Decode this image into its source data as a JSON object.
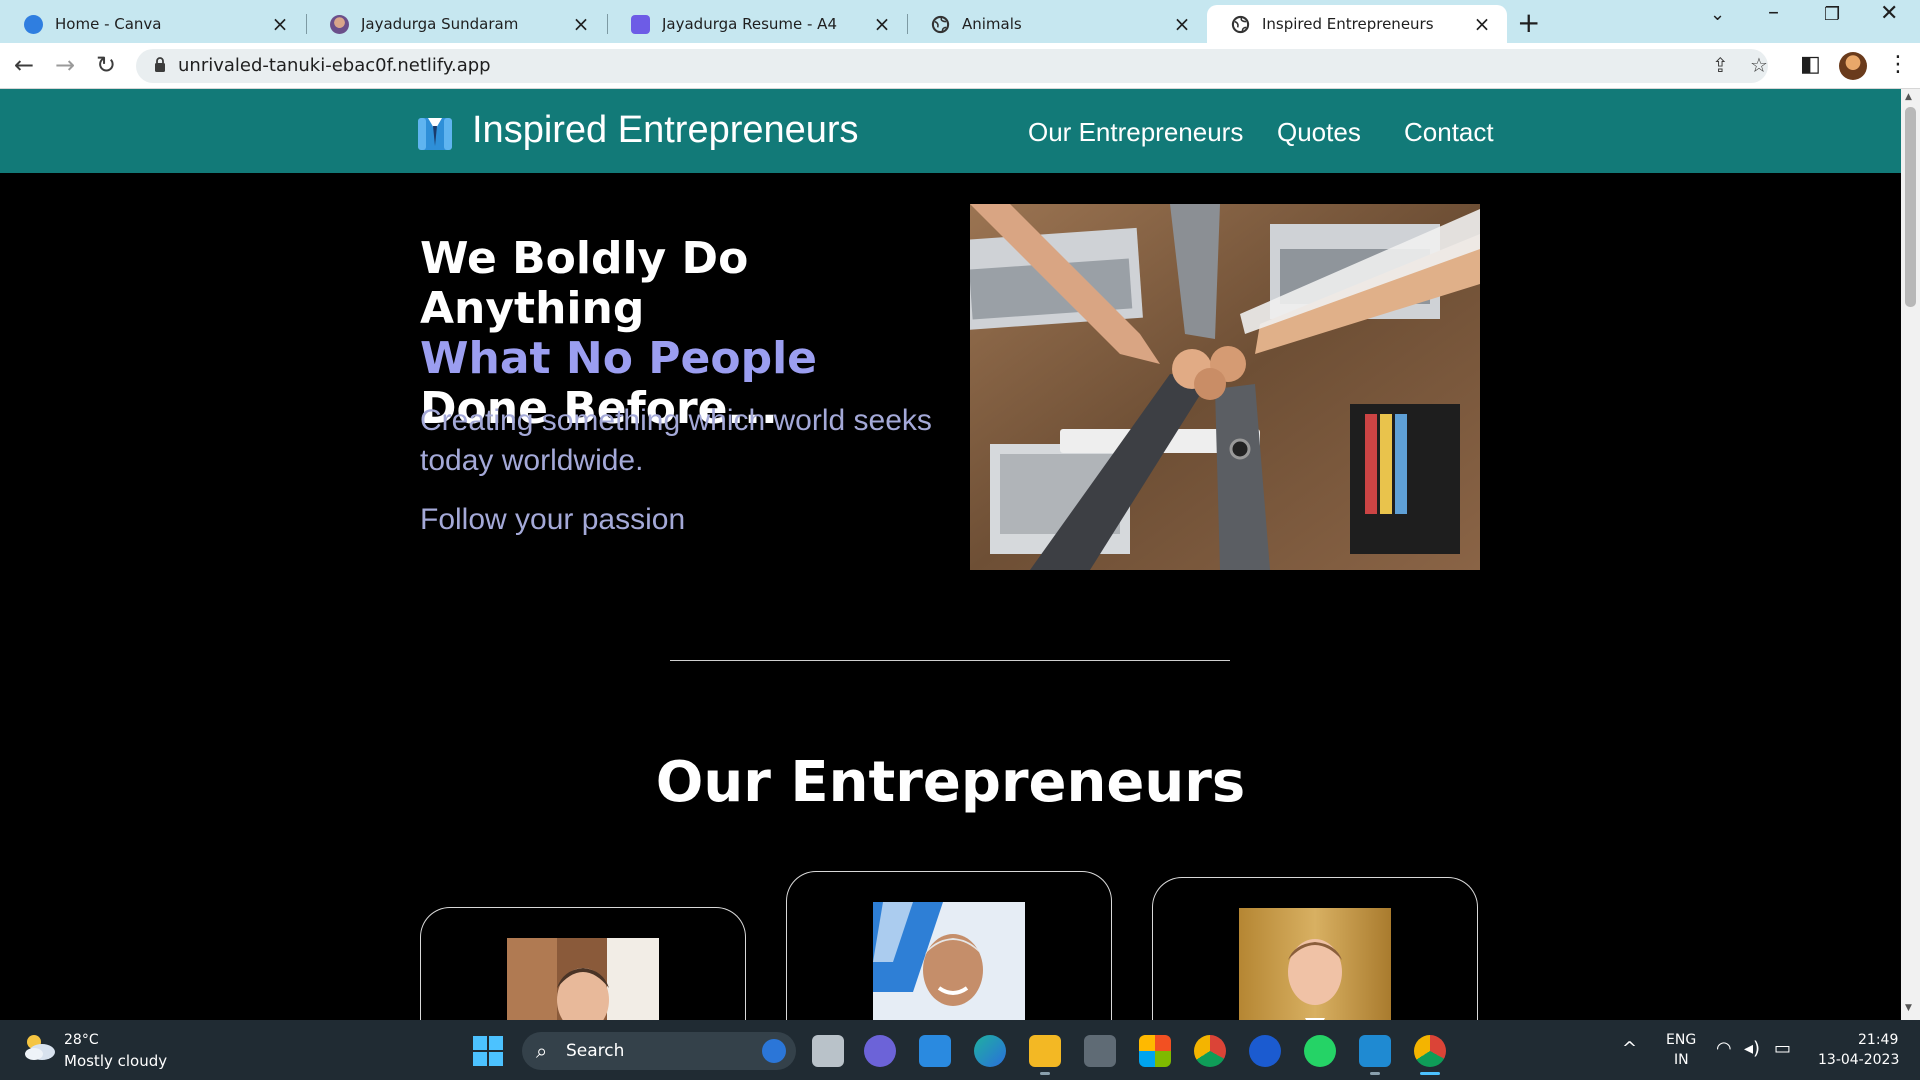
{
  "browser": {
    "tabs": [
      {
        "title": "Home - Canva",
        "icon": "canva-icon",
        "active": false
      },
      {
        "title": "Jayadurga Sundaram",
        "icon": "profile-photo-icon",
        "active": false
      },
      {
        "title": "Jayadurga Resume - A4",
        "icon": "printer-icon",
        "active": false
      },
      {
        "title": "Animals",
        "icon": "globe-icon",
        "active": false
      },
      {
        "title": "Inspired Entrepreneurs",
        "icon": "globe-icon",
        "active": true
      }
    ],
    "url": "unrivaled-tanuki-ebac0f.netlify.app"
  },
  "site": {
    "brand": "Inspired Entrepreneurs",
    "nav": [
      "Our Entrepreneurs",
      "Quotes",
      "Contact"
    ],
    "hero": {
      "heading_line1": "We Boldly Do Anything",
      "heading_accent": "What No People",
      "heading_rest": " Done Before...",
      "tagline": "Creating something which world seeks today worldwide.",
      "subtitle": "Follow your passion"
    },
    "section_title": "Our Entrepreneurs"
  },
  "colors": {
    "header_bg": "#127a78",
    "accent_text": "#9b9ef0",
    "muted_text": "#a4a9d8",
    "page_bg": "#000000"
  },
  "taskbar": {
    "weather_temp": "28°C",
    "weather_desc": "Mostly cloudy",
    "search_label": "Search",
    "lang_line1": "ENG",
    "lang_line2": "IN",
    "time": "21:49",
    "date": "13-04-2023"
  }
}
